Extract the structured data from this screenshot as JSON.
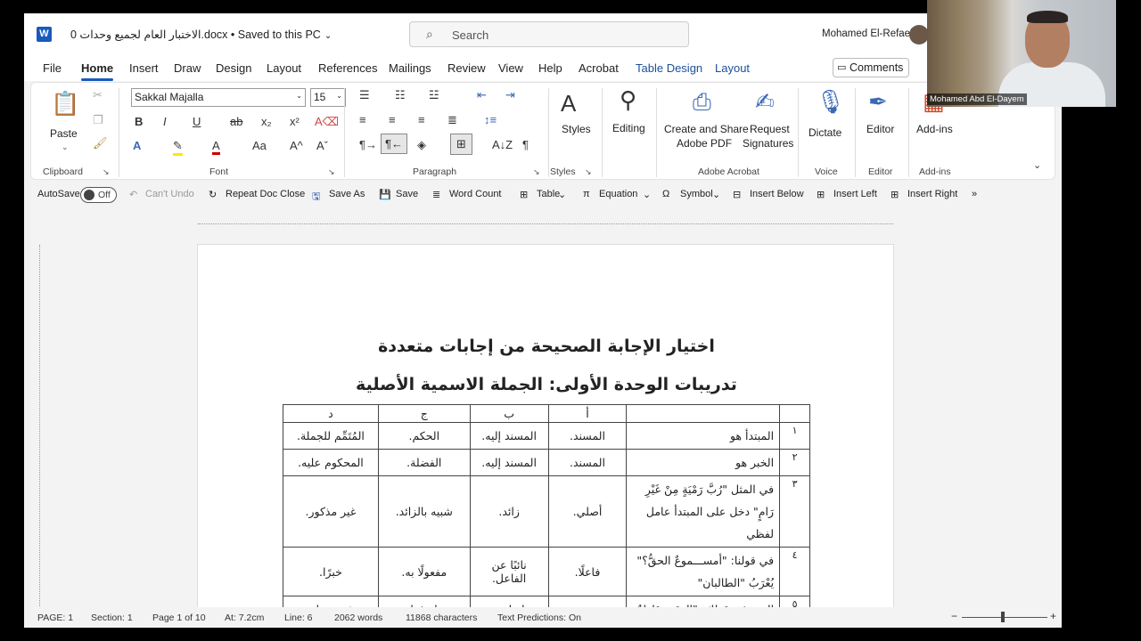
{
  "titlebar": {
    "doc_title": "الاختبار العام لجميع وحدات 0.docx • Saved to this PC",
    "search_placeholder": "Search",
    "user_name": "Mohamed El-Refaei"
  },
  "menu": {
    "tabs": [
      "File",
      "Home",
      "Insert",
      "Draw",
      "Design",
      "Layout",
      "References",
      "Mailings",
      "Review",
      "View",
      "Help",
      "Acrobat",
      "Table Design",
      "Layout"
    ],
    "active_tab": "Home",
    "comments_label": "Comments"
  },
  "ribbon": {
    "clipboard": {
      "paste": "Paste",
      "label": "Clipboard"
    },
    "font": {
      "name": "Sakkal Majalla",
      "size": "15",
      "label": "Font"
    },
    "paragraph": {
      "label": "Paragraph"
    },
    "styles": {
      "button": "Styles",
      "label": "Styles"
    },
    "editing": {
      "button": "Editing"
    },
    "acrobat": {
      "create_line1": "Create and Share",
      "create_line2": "Adobe PDF",
      "request_line1": "Request",
      "request_line2": "Signatures",
      "label": "Adobe Acrobat"
    },
    "voice": {
      "button": "Dictate",
      "label": "Voice"
    },
    "editor": {
      "button": "Editor",
      "label": "Editor"
    },
    "addins": {
      "button": "Add-ins",
      "label": "Add-ins"
    }
  },
  "qat": {
    "autosave": "AutoSave",
    "toggle_state": "Off",
    "cant_undo": "Can't Undo",
    "repeat": "Repeat Doc Close",
    "save_as": "Save As",
    "save": "Save",
    "word_count": "Word Count",
    "table": "Table",
    "equation": "Equation",
    "symbol": "Symbol",
    "insert_below": "Insert Below",
    "insert_left": "Insert Left",
    "insert_right": "Insert Right"
  },
  "document": {
    "heading1": "اختيار الإجابة الصحيحة من إجابات متعددة",
    "heading2": "تدريبات الوحدة الأولى: الجملة الاسمية الأصلية",
    "table": {
      "headers": [
        "",
        "",
        "أ",
        "ب",
        "ج",
        "د"
      ],
      "rows": [
        {
          "n": "١",
          "q": "المبتدأ هو",
          "a": "المسند.",
          "b": "المسند إليه.",
          "c": "الحكم.",
          "d": "المُتَمِّم للجملة."
        },
        {
          "n": "٢",
          "q": "الخبر هو",
          "a": "المسند.",
          "b": "المسند إليه.",
          "c": "الفضلة.",
          "d": "المحكوم عليه."
        },
        {
          "n": "٣",
          "q": "في المثل \"رُبَّ رَمْيَةٍ مِنْ غَيْرِ رَامٍ\" دخل على المبتدأ عامل لفظي",
          "a": "أصلي.",
          "b": "زائد.",
          "c": "شبيه بالزائد.",
          "d": "غير مذكور."
        },
        {
          "n": "٤",
          "q": "في قولنا: \"أمســـموعٌ الحقُّ؟\" يُعْرَبُ \"الطالبان\"",
          "a": "فاعلًا.",
          "b": "نائبًا عن الفاعل.",
          "c": "مفعولًا به.",
          "d": "خبرًا."
        },
        {
          "n": "٥",
          "q": "الخبر في قولك: \"الوقت قاطعٌ",
          "a": "مفرد.",
          "b": "جملة اسمية.",
          "c": "جملة فعلية.",
          "d": "شبه جملة."
        }
      ]
    }
  },
  "status": {
    "page": "PAGE: 1",
    "section": "Section: 1",
    "page_of": "Page 1 of 10",
    "at": "At: 7.2cm",
    "line": "Line: 6",
    "words": "2062 words",
    "chars": "11868 characters",
    "predictions": "Text Predictions: On"
  },
  "webcam": {
    "label": "Mohamed Abd El-Dayem"
  }
}
